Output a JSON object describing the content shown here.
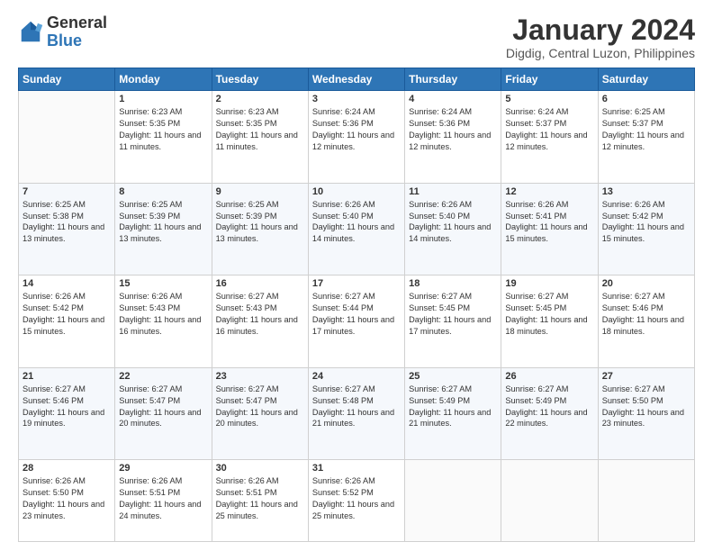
{
  "logo": {
    "line1": "General",
    "line2": "Blue"
  },
  "title": "January 2024",
  "subtitle": "Digdig, Central Luzon, Philippines",
  "weekdays": [
    "Sunday",
    "Monday",
    "Tuesday",
    "Wednesday",
    "Thursday",
    "Friday",
    "Saturday"
  ],
  "weeks": [
    [
      {
        "day": "",
        "sunrise": "",
        "sunset": "",
        "daylight": ""
      },
      {
        "day": "1",
        "sunrise": "Sunrise: 6:23 AM",
        "sunset": "Sunset: 5:35 PM",
        "daylight": "Daylight: 11 hours and 11 minutes."
      },
      {
        "day": "2",
        "sunrise": "Sunrise: 6:23 AM",
        "sunset": "Sunset: 5:35 PM",
        "daylight": "Daylight: 11 hours and 11 minutes."
      },
      {
        "day": "3",
        "sunrise": "Sunrise: 6:24 AM",
        "sunset": "Sunset: 5:36 PM",
        "daylight": "Daylight: 11 hours and 12 minutes."
      },
      {
        "day": "4",
        "sunrise": "Sunrise: 6:24 AM",
        "sunset": "Sunset: 5:36 PM",
        "daylight": "Daylight: 11 hours and 12 minutes."
      },
      {
        "day": "5",
        "sunrise": "Sunrise: 6:24 AM",
        "sunset": "Sunset: 5:37 PM",
        "daylight": "Daylight: 11 hours and 12 minutes."
      },
      {
        "day": "6",
        "sunrise": "Sunrise: 6:25 AM",
        "sunset": "Sunset: 5:37 PM",
        "daylight": "Daylight: 11 hours and 12 minutes."
      }
    ],
    [
      {
        "day": "7",
        "sunrise": "Sunrise: 6:25 AM",
        "sunset": "Sunset: 5:38 PM",
        "daylight": "Daylight: 11 hours and 13 minutes."
      },
      {
        "day": "8",
        "sunrise": "Sunrise: 6:25 AM",
        "sunset": "Sunset: 5:39 PM",
        "daylight": "Daylight: 11 hours and 13 minutes."
      },
      {
        "day": "9",
        "sunrise": "Sunrise: 6:25 AM",
        "sunset": "Sunset: 5:39 PM",
        "daylight": "Daylight: 11 hours and 13 minutes."
      },
      {
        "day": "10",
        "sunrise": "Sunrise: 6:26 AM",
        "sunset": "Sunset: 5:40 PM",
        "daylight": "Daylight: 11 hours and 14 minutes."
      },
      {
        "day": "11",
        "sunrise": "Sunrise: 6:26 AM",
        "sunset": "Sunset: 5:40 PM",
        "daylight": "Daylight: 11 hours and 14 minutes."
      },
      {
        "day": "12",
        "sunrise": "Sunrise: 6:26 AM",
        "sunset": "Sunset: 5:41 PM",
        "daylight": "Daylight: 11 hours and 15 minutes."
      },
      {
        "day": "13",
        "sunrise": "Sunrise: 6:26 AM",
        "sunset": "Sunset: 5:42 PM",
        "daylight": "Daylight: 11 hours and 15 minutes."
      }
    ],
    [
      {
        "day": "14",
        "sunrise": "Sunrise: 6:26 AM",
        "sunset": "Sunset: 5:42 PM",
        "daylight": "Daylight: 11 hours and 15 minutes."
      },
      {
        "day": "15",
        "sunrise": "Sunrise: 6:26 AM",
        "sunset": "Sunset: 5:43 PM",
        "daylight": "Daylight: 11 hours and 16 minutes."
      },
      {
        "day": "16",
        "sunrise": "Sunrise: 6:27 AM",
        "sunset": "Sunset: 5:43 PM",
        "daylight": "Daylight: 11 hours and 16 minutes."
      },
      {
        "day": "17",
        "sunrise": "Sunrise: 6:27 AM",
        "sunset": "Sunset: 5:44 PM",
        "daylight": "Daylight: 11 hours and 17 minutes."
      },
      {
        "day": "18",
        "sunrise": "Sunrise: 6:27 AM",
        "sunset": "Sunset: 5:45 PM",
        "daylight": "Daylight: 11 hours and 17 minutes."
      },
      {
        "day": "19",
        "sunrise": "Sunrise: 6:27 AM",
        "sunset": "Sunset: 5:45 PM",
        "daylight": "Daylight: 11 hours and 18 minutes."
      },
      {
        "day": "20",
        "sunrise": "Sunrise: 6:27 AM",
        "sunset": "Sunset: 5:46 PM",
        "daylight": "Daylight: 11 hours and 18 minutes."
      }
    ],
    [
      {
        "day": "21",
        "sunrise": "Sunrise: 6:27 AM",
        "sunset": "Sunset: 5:46 PM",
        "daylight": "Daylight: 11 hours and 19 minutes."
      },
      {
        "day": "22",
        "sunrise": "Sunrise: 6:27 AM",
        "sunset": "Sunset: 5:47 PM",
        "daylight": "Daylight: 11 hours and 20 minutes."
      },
      {
        "day": "23",
        "sunrise": "Sunrise: 6:27 AM",
        "sunset": "Sunset: 5:47 PM",
        "daylight": "Daylight: 11 hours and 20 minutes."
      },
      {
        "day": "24",
        "sunrise": "Sunrise: 6:27 AM",
        "sunset": "Sunset: 5:48 PM",
        "daylight": "Daylight: 11 hours and 21 minutes."
      },
      {
        "day": "25",
        "sunrise": "Sunrise: 6:27 AM",
        "sunset": "Sunset: 5:49 PM",
        "daylight": "Daylight: 11 hours and 21 minutes."
      },
      {
        "day": "26",
        "sunrise": "Sunrise: 6:27 AM",
        "sunset": "Sunset: 5:49 PM",
        "daylight": "Daylight: 11 hours and 22 minutes."
      },
      {
        "day": "27",
        "sunrise": "Sunrise: 6:27 AM",
        "sunset": "Sunset: 5:50 PM",
        "daylight": "Daylight: 11 hours and 23 minutes."
      }
    ],
    [
      {
        "day": "28",
        "sunrise": "Sunrise: 6:26 AM",
        "sunset": "Sunset: 5:50 PM",
        "daylight": "Daylight: 11 hours and 23 minutes."
      },
      {
        "day": "29",
        "sunrise": "Sunrise: 6:26 AM",
        "sunset": "Sunset: 5:51 PM",
        "daylight": "Daylight: 11 hours and 24 minutes."
      },
      {
        "day": "30",
        "sunrise": "Sunrise: 6:26 AM",
        "sunset": "Sunset: 5:51 PM",
        "daylight": "Daylight: 11 hours and 25 minutes."
      },
      {
        "day": "31",
        "sunrise": "Sunrise: 6:26 AM",
        "sunset": "Sunset: 5:52 PM",
        "daylight": "Daylight: 11 hours and 25 minutes."
      },
      {
        "day": "",
        "sunrise": "",
        "sunset": "",
        "daylight": ""
      },
      {
        "day": "",
        "sunrise": "",
        "sunset": "",
        "daylight": ""
      },
      {
        "day": "",
        "sunrise": "",
        "sunset": "",
        "daylight": ""
      }
    ]
  ]
}
